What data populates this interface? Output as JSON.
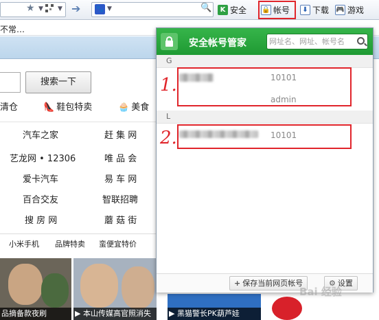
{
  "toolbar": {
    "account_label": "帐号",
    "security_label": "安全",
    "download_label": "下载",
    "games_label": "游戏"
  },
  "row2": {
    "text": "不常…"
  },
  "page": {
    "search_button": "搜索一下",
    "categories": [
      "清仓",
      "鞋包特卖",
      "美食"
    ],
    "sites": [
      [
        "汽车之家",
        "赶 集 网"
      ],
      [
        "艺龙网 • 12306",
        "唯 品 会"
      ],
      [
        "爱卡汽车",
        "易 车 网"
      ],
      [
        "百合交友",
        "智联招聘"
      ],
      [
        "搜 房 网",
        "蘑 菇 街"
      ]
    ],
    "tabs": [
      "小米手机",
      "品牌特卖",
      "蛮便宜特价"
    ],
    "news": [
      "品摘备款夜刷",
      "本山传媒高官照消失",
      "黑猫警长PK葫芦娃"
    ]
  },
  "popup": {
    "title": "安全帐号管家",
    "search_placeholder": "网址名、网址、帐号名",
    "groups": [
      {
        "letter": "G",
        "entries": [
          {
            "number": "10101",
            "username": "admin",
            "marker": "1."
          }
        ]
      },
      {
        "letter": "L",
        "entries": [
          {
            "number": "10101",
            "marker": "2."
          }
        ]
      }
    ],
    "save_button": "保存当前网页帐号",
    "settings_button": "设置"
  },
  "watermark": "Bai 经验"
}
